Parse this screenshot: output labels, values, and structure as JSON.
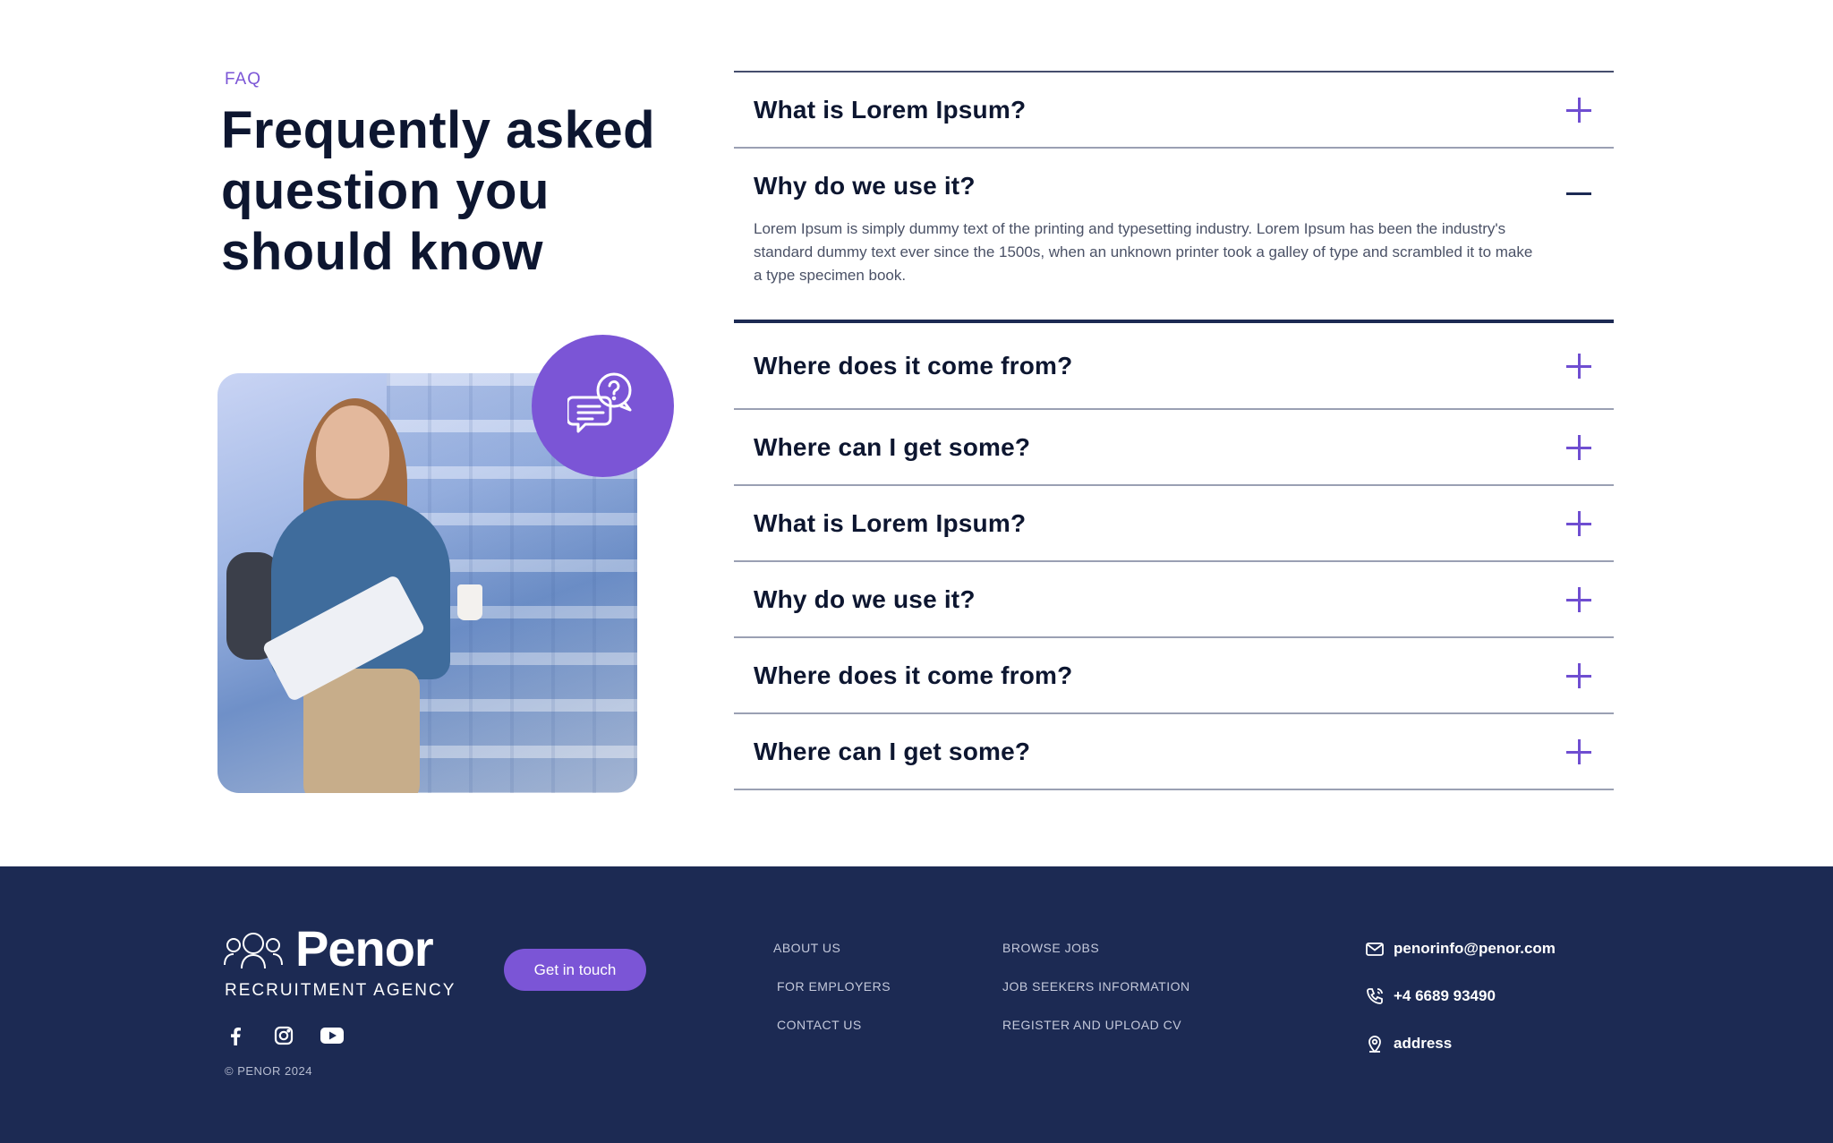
{
  "faq": {
    "eyebrow": "FAQ",
    "heading": "Frequently asked question you should know",
    "items": [
      {
        "question": "What is Lorem Ipsum?",
        "open": false
      },
      {
        "question": "Why do we use it?",
        "open": true,
        "answer": "Lorem Ipsum is simply dummy text of the printing and typesetting industry. Lorem Ipsum has been the industry's standard dummy text ever since the 1500s, when an unknown printer took a galley of type and scrambled it to make a type specimen book."
      },
      {
        "question": "Where does it come from?",
        "open": false
      },
      {
        "question": "Where can I get some?",
        "open": false
      },
      {
        "question": "What is Lorem Ipsum?",
        "open": false
      },
      {
        "question": "Why do we use it?",
        "open": false
      },
      {
        "question": "Where does it come from?",
        "open": false
      },
      {
        "question": "Where can I get some?",
        "open": false
      }
    ],
    "badge_icon": "chat-question-icon",
    "expand_icon": "plus-icon",
    "collapse_icon": "minus-icon"
  },
  "footer": {
    "brand": "Penor",
    "brand_tagline": "RECRUITMENT AGENCY",
    "cta_label": "Get in touch",
    "copyright": "© PENOR 2024",
    "socials": [
      "facebook-icon",
      "instagram-icon",
      "youtube-icon"
    ],
    "nav_col_1": [
      "ABOUT US",
      "FOR EMPLOYERS",
      "CONTACT US"
    ],
    "nav_col_2": [
      "BROWSE JOBS",
      "JOB SEEKERS INFORMATION",
      "REGISTER AND UPLOAD CV"
    ],
    "contact": {
      "email": "penorinfo@penor.com",
      "phone": "+4 6689 93490",
      "address": "address"
    }
  },
  "colors": {
    "accent": "#7b55d6",
    "navy": "#1c2a53",
    "heading": "#0d1630"
  }
}
